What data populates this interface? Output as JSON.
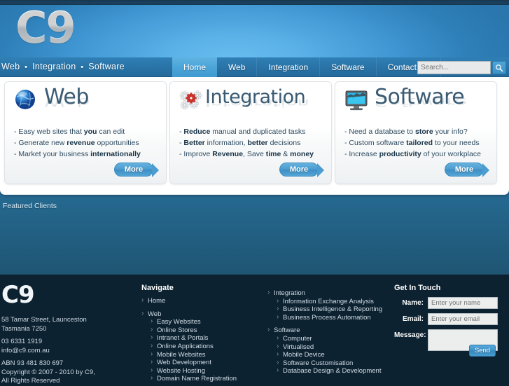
{
  "brand": {
    "logo": "C9",
    "tagline_parts": [
      "Web",
      "Integration",
      "Software"
    ],
    "tagline_sep": "•"
  },
  "nav": {
    "items": [
      {
        "label": "Home",
        "active": true
      },
      {
        "label": "Web",
        "active": false
      },
      {
        "label": "Integration",
        "active": false
      },
      {
        "label": "Software",
        "active": false
      },
      {
        "label": "Contact Us",
        "active": false
      }
    ],
    "search_placeholder": "Search...",
    "search_value": "",
    "search_icon": "search-icon"
  },
  "cards": [
    {
      "title": "Web",
      "icon": "globe-icon",
      "more_label": "More",
      "bullets": [
        [
          {
            "t": "- Easy web sites that ",
            "b": false
          },
          {
            "t": "you",
            "b": true
          },
          {
            "t": " can edit",
            "b": false
          }
        ],
        [
          {
            "t": "- Generate new ",
            "b": false
          },
          {
            "t": "revenue",
            "b": true
          },
          {
            "t": " opportunities",
            "b": false
          }
        ],
        [
          {
            "t": "- Market your business ",
            "b": false
          },
          {
            "t": "internationally",
            "b": true
          }
        ]
      ]
    },
    {
      "title": "Integration",
      "icon": "gears-icon",
      "more_label": "More",
      "bullets": [
        [
          {
            "t": "- ",
            "b": false
          },
          {
            "t": "Reduce",
            "b": true
          },
          {
            "t": " manual and duplicated tasks",
            "b": false
          }
        ],
        [
          {
            "t": "- ",
            "b": false
          },
          {
            "t": "Better",
            "b": true
          },
          {
            "t": " information, ",
            "b": false
          },
          {
            "t": "better",
            "b": true
          },
          {
            "t": " decisions",
            "b": false
          }
        ],
        [
          {
            "t": "- Improve ",
            "b": false
          },
          {
            "t": "Revenue",
            "b": true
          },
          {
            "t": ", Save ",
            "b": false
          },
          {
            "t": "time",
            "b": true
          },
          {
            "t": " & ",
            "b": false
          },
          {
            "t": "money",
            "b": true
          }
        ]
      ]
    },
    {
      "title": "Software",
      "icon": "monitor-icon",
      "more_label": "More",
      "bullets": [
        [
          {
            "t": "- Need a database to ",
            "b": false
          },
          {
            "t": "store",
            "b": true
          },
          {
            "t": " your info?",
            "b": false
          }
        ],
        [
          {
            "t": "- Custom software ",
            "b": false
          },
          {
            "t": "tailored",
            "b": true
          },
          {
            "t": " to your needs",
            "b": false
          }
        ],
        [
          {
            "t": "- Increase ",
            "b": false
          },
          {
            "t": "productivity",
            "b": true
          },
          {
            "t": " of your workplace",
            "b": false
          }
        ]
      ]
    }
  ],
  "featured_clients_label": "Featured Clients",
  "footer": {
    "logo": "C9",
    "address_line1": "58 Tamar Street, Launceston",
    "address_line2": "Tasmania 7250",
    "phone": "03 6331 1919",
    "email": "info@c9.com.au",
    "abn": "ABN 93 481 830 697",
    "copyright": "Copyright © 2007 - 2010 by C9,",
    "rights": "All Rights Reserved",
    "navigate_title": "Navigate",
    "nav_col1": [
      {
        "label": "Home",
        "sub": false
      },
      {
        "label": "",
        "sub": false,
        "spacer": true
      },
      {
        "label": "Web",
        "sub": false
      },
      {
        "label": "Easy Websites",
        "sub": true
      },
      {
        "label": "Online Stores",
        "sub": true
      },
      {
        "label": "Intranet & Portals",
        "sub": true
      },
      {
        "label": "Online Applications",
        "sub": true
      },
      {
        "label": "Mobile Websites",
        "sub": true
      },
      {
        "label": "Web Development",
        "sub": true
      },
      {
        "label": "Website Hosting",
        "sub": true
      },
      {
        "label": "Domain Name Registration",
        "sub": true
      }
    ],
    "nav_col2": [
      {
        "label": "Integration",
        "sub": false
      },
      {
        "label": "Information Exchange Analysis",
        "sub": true
      },
      {
        "label": "Business Intelligence & Reporting",
        "sub": true
      },
      {
        "label": "Business Process Automation",
        "sub": true
      },
      {
        "label": "",
        "sub": false,
        "spacer": true
      },
      {
        "label": "Software",
        "sub": false
      },
      {
        "label": "Computer",
        "sub": true
      },
      {
        "label": "Virtualised",
        "sub": true
      },
      {
        "label": "Mobile Device",
        "sub": true
      },
      {
        "label": "Software Customisation",
        "sub": true
      },
      {
        "label": "Database Design & Development",
        "sub": true
      }
    ],
    "contact_title": "Get In Touch",
    "name_label": "Name:",
    "name_placeholder": "Enter your name",
    "name_value": "",
    "email_label": "Email:",
    "email_placeholder": "Enter your email",
    "email_value": "",
    "message_label": "Message:",
    "message_value": "",
    "send_label": "Send"
  },
  "colors": {
    "header_light": "#5bb2e8",
    "header_dark": "#2a76ad",
    "nav_bar": "#2a75a9",
    "nav_active": "#4aa3d6",
    "body_top": "#2f83b9",
    "body_bottom": "#1f5573",
    "footer_bg": "#0d2231",
    "card_text": "#2c4a60",
    "card_title": "#3a5b73"
  }
}
